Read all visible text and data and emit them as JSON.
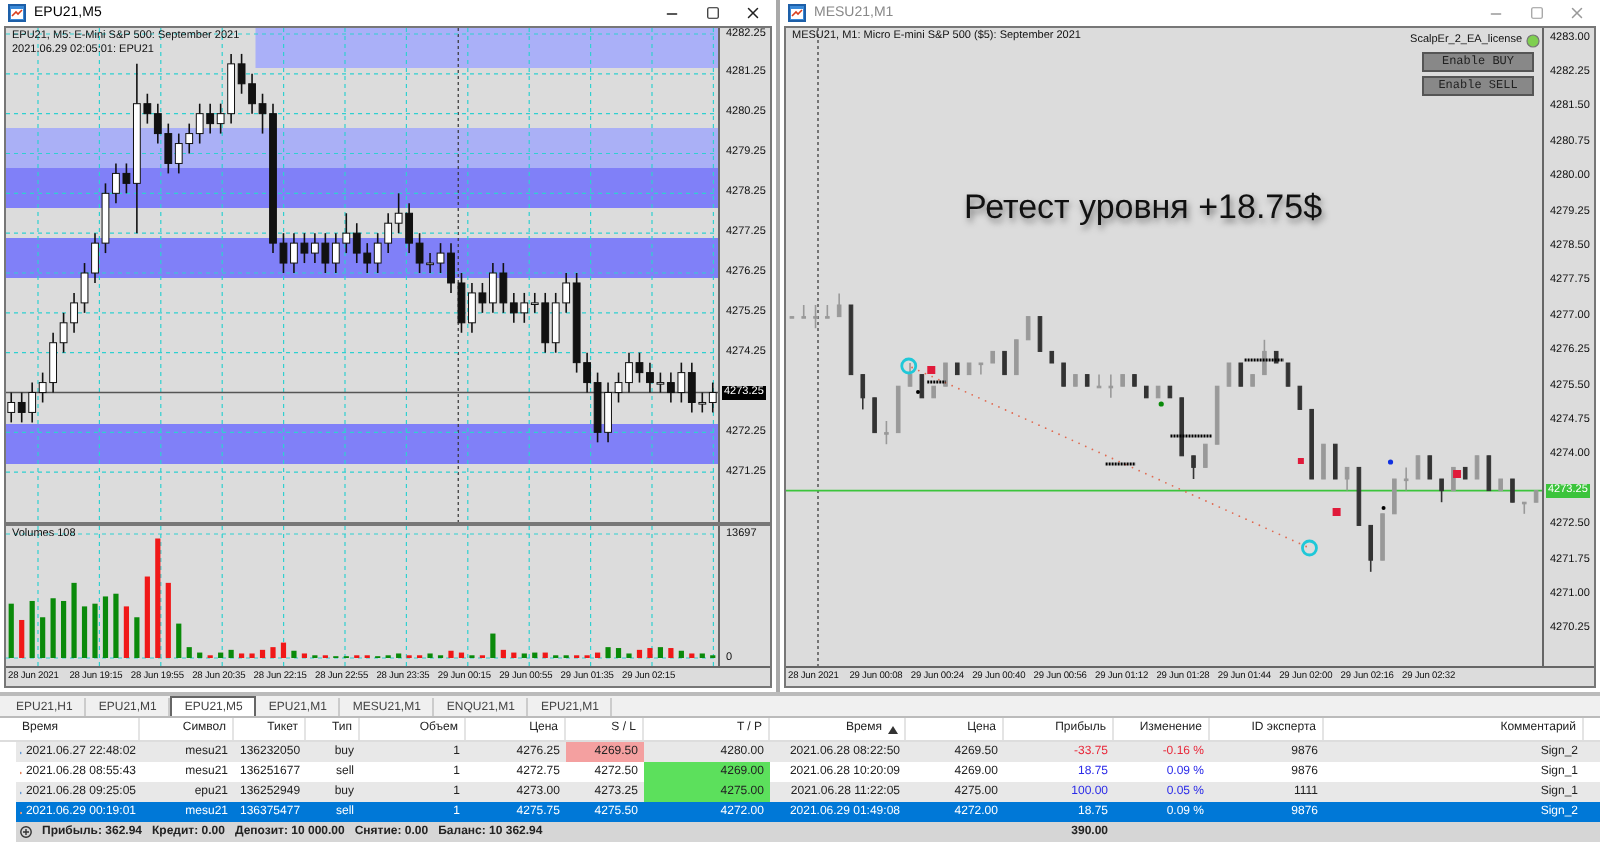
{
  "windows": [
    {
      "title": "EPU21,M5",
      "active": true,
      "chart": {
        "kind": "candles",
        "info": [
          "EPU21, M5:  E-Mini S&P 500: September 2021",
          "2021.06.29 02:05:01: EPU21"
        ],
        "chart_data": {
          "type": "candlestick",
          "ylim": [
            4270.0,
            4282.4
          ],
          "yticks": [
            {
              "value": 4282.25,
              "label": "4282.25"
            },
            {
              "value": 4281.25,
              "label": "4281.25"
            },
            {
              "value": 4280.25,
              "label": "4280.25"
            },
            {
              "value": 4279.25,
              "label": "4279.25"
            },
            {
              "value": 4278.25,
              "label": "4278.25"
            },
            {
              "value": 4277.25,
              "label": "4277.25"
            },
            {
              "value": 4276.25,
              "label": "4276.25"
            },
            {
              "value": 4275.25,
              "label": "4275.25"
            },
            {
              "value": 4274.25,
              "label": "4274.25"
            },
            {
              "value": 4272.25,
              "label": "4272.25"
            },
            {
              "value": 4271.25,
              "label": "4271.25"
            }
          ],
          "grid": true,
          "ref_lines": [
            {
              "axis": "y",
              "value": 4273.25
            }
          ],
          "annotations": [
            "4273.25"
          ],
          "categories": [
            null,
            null,
            null,
            null,
            null,
            null,
            null,
            null,
            null,
            null,
            null,
            null,
            null,
            null,
            null,
            null,
            null,
            null,
            null,
            null,
            null,
            null,
            null,
            null,
            null,
            null,
            null,
            null,
            null,
            null,
            null,
            null,
            null,
            null,
            null,
            null,
            null,
            null,
            null,
            null,
            null,
            null,
            null,
            null,
            null,
            null,
            null,
            null,
            null,
            null,
            null,
            null,
            null,
            null,
            null,
            null,
            null,
            null,
            null,
            null,
            null,
            null,
            null,
            null,
            null,
            null,
            null,
            null
          ],
          "ohlc": [
            [
              4272.75,
              4273.25,
              4272.5,
              4273.0
            ],
            [
              4273.0,
              4273.25,
              4272.5,
              4272.75
            ],
            [
              4272.75,
              4273.5,
              4272.5,
              4273.25
            ],
            [
              4273.25,
              4273.75,
              4273.0,
              4273.5
            ],
            [
              4273.5,
              4274.75,
              4273.25,
              4274.5
            ],
            [
              4274.5,
              4275.25,
              4274.25,
              4275.0
            ],
            [
              4275.0,
              4275.75,
              4274.75,
              4275.5
            ],
            [
              4275.5,
              4276.5,
              4275.25,
              4276.25
            ],
            [
              4276.25,
              4277.25,
              4276.0,
              4277.0
            ],
            [
              4277.0,
              4278.5,
              4276.75,
              4278.25
            ],
            [
              4278.25,
              4279.0,
              4278.0,
              4278.75
            ],
            [
              4278.75,
              4279.0,
              4278.25,
              4278.5
            ],
            [
              4278.5,
              4281.5,
              4277.25,
              4280.5
            ],
            [
              4280.5,
              4280.75,
              4280.0,
              4280.25
            ],
            [
              4280.25,
              4280.5,
              4279.5,
              4279.75
            ],
            [
              4279.75,
              4280.0,
              4278.75,
              4279.0
            ],
            [
              4279.0,
              4279.75,
              4278.75,
              4279.5
            ],
            [
              4279.5,
              4280.0,
              4279.25,
              4279.75
            ],
            [
              4279.75,
              4280.5,
              4279.5,
              4280.25
            ],
            [
              4280.25,
              4280.5,
              4279.75,
              4280.0
            ],
            [
              4280.0,
              4280.5,
              4279.75,
              4280.25
            ],
            [
              4280.25,
              4281.75,
              4280.0,
              4281.5
            ],
            [
              4281.5,
              4281.75,
              4280.75,
              4281.0
            ],
            [
              4281.0,
              4281.25,
              4280.25,
              4280.5
            ],
            [
              4280.5,
              4280.75,
              4279.75,
              4280.25
            ],
            [
              4280.25,
              4280.5,
              4276.75,
              4277.0
            ],
            [
              4277.0,
              4277.25,
              4276.25,
              4276.5
            ],
            [
              4276.5,
              4277.25,
              4276.25,
              4277.0
            ],
            [
              4277.0,
              4277.25,
              4276.5,
              4276.75
            ],
            [
              4276.75,
              4277.25,
              4276.5,
              4277.0
            ],
            [
              4277.0,
              4277.25,
              4276.25,
              4276.5
            ],
            [
              4276.5,
              4277.25,
              4276.25,
              4277.0
            ],
            [
              4277.0,
              4277.75,
              4276.75,
              4277.25
            ],
            [
              4277.25,
              4277.5,
              4276.5,
              4276.75
            ],
            [
              4276.75,
              4277.0,
              4276.25,
              4276.5
            ],
            [
              4276.5,
              4277.25,
              4276.25,
              4277.0
            ],
            [
              4277.0,
              4277.75,
              4276.75,
              4277.5
            ],
            [
              4277.5,
              4278.25,
              4277.25,
              4277.75
            ],
            [
              4277.75,
              4278.0,
              4276.75,
              4277.0
            ],
            [
              4277.0,
              4277.25,
              4276.25,
              4276.5
            ],
            [
              4276.5,
              4276.75,
              4276.25,
              4276.5
            ],
            [
              4276.5,
              4277.0,
              4276.25,
              4276.75
            ],
            [
              4276.75,
              4277.0,
              4275.75,
              4276.0
            ],
            [
              4276.0,
              4276.25,
              4274.75,
              4275.0
            ],
            [
              4275.0,
              4276.0,
              4274.75,
              4275.75
            ],
            [
              4275.75,
              4276.0,
              4275.25,
              4275.5
            ],
            [
              4275.5,
              4276.5,
              4275.25,
              4276.25
            ],
            [
              4276.25,
              4276.5,
              4275.25,
              4275.5
            ],
            [
              4275.5,
              4275.75,
              4275.0,
              4275.25
            ],
            [
              4275.25,
              4275.75,
              4275.0,
              4275.5
            ],
            [
              4275.5,
              4275.75,
              4275.25,
              4275.5
            ],
            [
              4275.5,
              4275.75,
              4274.25,
              4274.5
            ],
            [
              4274.5,
              4275.75,
              4274.25,
              4275.5
            ],
            [
              4275.5,
              4276.25,
              4275.25,
              4276.0
            ],
            [
              4276.0,
              4276.25,
              4273.75,
              4274.0
            ],
            [
              4274.0,
              4274.25,
              4273.25,
              4273.5
            ],
            [
              4273.5,
              4273.75,
              4272.0,
              4272.25
            ],
            [
              4272.25,
              4273.5,
              4272.0,
              4273.25
            ],
            [
              4273.25,
              4273.75,
              4273.0,
              4273.5
            ],
            [
              4273.5,
              4274.25,
              4273.25,
              4274.0
            ],
            [
              4274.0,
              4274.25,
              4273.5,
              4273.75
            ],
            [
              4273.75,
              4274.0,
              4273.25,
              4273.5
            ],
            [
              4273.5,
              4273.75,
              4273.25,
              4273.5
            ],
            [
              4273.5,
              4273.75,
              4273.0,
              4273.25
            ],
            [
              4273.25,
              4274.0,
              4273.0,
              4273.75
            ],
            [
              4273.75,
              4274.0,
              4272.75,
              4273.0
            ],
            [
              4273.0,
              4273.25,
              4272.75,
              4273.0
            ],
            [
              4273.0,
              4273.5,
              4272.75,
              4273.25
            ]
          ]
        },
        "volume": {
          "label": "Volumes 108",
          "chart_data": {
            "type": "bar",
            "ylim": [
              0,
              13697
            ],
            "grid": true,
            "yticks": [
              {
                "value": 13697,
                "label": "13697"
              },
              {
                "value": 0,
                "label": "0"
              }
            ],
            "categories": [
              null,
              null,
              null,
              null,
              null,
              null,
              null,
              null,
              null,
              null,
              null,
              null,
              null,
              null,
              null,
              null,
              null,
              null,
              null,
              null,
              null,
              null,
              null,
              null,
              null,
              null,
              null,
              null,
              null,
              null,
              null,
              null,
              null,
              null,
              null,
              null,
              null,
              null,
              null,
              null,
              null,
              null,
              null,
              null,
              null,
              null,
              null,
              null,
              null,
              null,
              null,
              null,
              null,
              null,
              null,
              null,
              null,
              null,
              null,
              null,
              null,
              null,
              null,
              null,
              null,
              null,
              null,
              null
            ],
            "values": [
              6000,
              4200,
              6300,
              4500,
              6600,
              6300,
              8300,
              5700,
              6000,
              6800,
              7100,
              5700,
              4500,
              9000,
              13200,
              8300,
              3800,
              1200,
              600,
              300,
              600,
              900,
              500,
              500,
              900,
              1200,
              1700,
              800,
              500,
              300,
              300,
              200,
              200,
              300,
              300,
              200,
              300,
              500,
              300,
              300,
              500,
              300,
              800,
              600,
              300,
              300,
              2700,
              900,
              600,
              500,
              600,
              600,
              300,
              300,
              300,
              300,
              600,
              1200,
              1100,
              500,
              900,
              1100,
              1200,
              1100,
              800,
              500,
              500,
              300
            ]
          }
        },
        "time_labels": [
          "28 Jun 2021",
          "28 Jun 19:15",
          "28 Jun 19:55",
          "28 Jun 20:35",
          "28 Jun 22:15",
          "28 Jun 22:55",
          "28 Jun 23:35",
          "29 Jun 00:15",
          "29 Jun 00:55",
          "29 Jun 01:35",
          "29 Jun 02:15"
        ]
      }
    },
    {
      "title": "MESU21,M1",
      "active": false,
      "chart": {
        "kind": "bars",
        "info": [
          "MESU21, M1:  Micro E-mini S&P 500 ($5): September 2021"
        ],
        "expert": "ScalpEr_2_EA_license",
        "buttons": [
          "Enable BUY",
          "Enable SELL"
        ],
        "caption": "Ретест уровня +18.75$",
        "chart_data": {
          "type": "candlestick",
          "ylim": [
            4269.47,
            4283.22
          ],
          "yticks": [
            {
              "value": 4283.0,
              "label": "4283.00"
            },
            {
              "value": 4282.25,
              "label": "4282.25"
            },
            {
              "value": 4281.5,
              "label": "4281.50"
            },
            {
              "value": 4280.75,
              "label": "4280.75"
            },
            {
              "value": 4280.0,
              "label": "4280.00"
            },
            {
              "value": 4279.25,
              "label": "4279.25"
            },
            {
              "value": 4278.5,
              "label": "4278.50"
            },
            {
              "value": 4277.75,
              "label": "4277.75"
            },
            {
              "value": 4277.0,
              "label": "4277.00"
            },
            {
              "value": 4276.25,
              "label": "4276.25"
            },
            {
              "value": 4275.5,
              "label": "4275.50"
            },
            {
              "value": 4274.75,
              "label": "4274.75"
            },
            {
              "value": 4274.0,
              "label": "4274.00"
            },
            {
              "value": 4272.5,
              "label": "4272.50"
            },
            {
              "value": 4271.75,
              "label": "4271.75"
            },
            {
              "value": 4271.0,
              "label": "4271.00"
            },
            {
              "value": 4270.25,
              "label": "4270.25"
            }
          ],
          "grid": false,
          "ref_lines": [
            {
              "axis": "y",
              "value": 4273.25
            }
          ],
          "annotations": [
            "4273.25"
          ],
          "categories": [
            null,
            null,
            null,
            null,
            null,
            null,
            null,
            null,
            null,
            null,
            null,
            null,
            null,
            null,
            null,
            null,
            null,
            null,
            null,
            null,
            null,
            null,
            null,
            null,
            null,
            null,
            null,
            null,
            null,
            null,
            null,
            null,
            null,
            null,
            null,
            null,
            null,
            null,
            null,
            null,
            null,
            null,
            null,
            null,
            null,
            null,
            null,
            null,
            null,
            null,
            null,
            null,
            null,
            null,
            null,
            null,
            null,
            null,
            null,
            null,
            null,
            null,
            null,
            null
          ],
          "ohlc": [
            [
              4277.0,
              4277.0,
              4277.0,
              4277.0
            ],
            [
              4277.0,
              4277.25,
              4277.0,
              4277.0
            ],
            [
              4277.0,
              4277.25,
              4276.75,
              4277.0
            ],
            [
              4277.0,
              4277.25,
              4277.0,
              4277.0
            ],
            [
              4277.0,
              4277.5,
              4277.0,
              4277.25
            ],
            [
              4277.25,
              4277.25,
              4275.75,
              4275.75
            ],
            [
              4275.75,
              4275.75,
              4275.0,
              4275.25
            ],
            [
              4275.25,
              4275.25,
              4274.5,
              4274.5
            ],
            [
              4274.5,
              4274.75,
              4274.25,
              4274.5
            ],
            [
              4274.5,
              4275.5,
              4274.5,
              4275.5
            ],
            [
              4275.5,
              4276.0,
              4275.5,
              4275.75
            ],
            [
              4275.75,
              4275.75,
              4275.25,
              4275.25
            ],
            [
              4275.25,
              4275.5,
              4275.25,
              4275.5
            ],
            [
              4275.5,
              4276.0,
              4275.5,
              4276.0
            ],
            [
              4276.0,
              4276.0,
              4275.75,
              4275.75
            ],
            [
              4275.75,
              4276.0,
              4275.75,
              4276.0
            ],
            [
              4276.0,
              4276.0,
              4275.75,
              4276.0
            ],
            [
              4276.0,
              4276.25,
              4276.0,
              4276.25
            ],
            [
              4276.25,
              4276.25,
              4275.75,
              4275.75
            ],
            [
              4275.75,
              4276.5,
              4275.75,
              4276.5
            ],
            [
              4276.5,
              4277.0,
              4276.5,
              4277.0
            ],
            [
              4277.0,
              4277.0,
              4276.25,
              4276.25
            ],
            [
              4276.25,
              4276.25,
              4276.0,
              4276.0
            ],
            [
              4276.0,
              4276.0,
              4275.5,
              4275.5
            ],
            [
              4275.5,
              4275.75,
              4275.5,
              4275.75
            ],
            [
              4275.75,
              4275.75,
              4275.5,
              4275.5
            ],
            [
              4275.5,
              4275.75,
              4275.5,
              4275.5
            ],
            [
              4275.5,
              4275.75,
              4275.25,
              4275.5
            ],
            [
              4275.5,
              4275.75,
              4275.5,
              4275.75
            ],
            [
              4275.75,
              4275.75,
              4275.5,
              4275.5
            ],
            [
              4275.5,
              4275.5,
              4275.25,
              4275.25
            ],
            [
              4275.25,
              4275.5,
              4275.25,
              4275.5
            ],
            [
              4275.5,
              4275.5,
              4275.25,
              4275.25
            ],
            [
              4275.25,
              4275.25,
              4274.0,
              4274.0
            ],
            [
              4274.0,
              4274.0,
              4273.5,
              4273.75
            ],
            [
              4273.75,
              4274.25,
              4273.75,
              4274.25
            ],
            [
              4274.25,
              4275.5,
              4274.25,
              4275.5
            ],
            [
              4275.5,
              4276.0,
              4275.5,
              4276.0
            ],
            [
              4276.0,
              4276.0,
              4275.5,
              4275.5
            ],
            [
              4275.5,
              4275.75,
              4275.5,
              4275.75
            ],
            [
              4275.75,
              4276.5,
              4275.75,
              4276.25
            ],
            [
              4276.25,
              4276.25,
              4276.0,
              4276.0
            ],
            [
              4276.0,
              4276.0,
              4275.5,
              4275.5
            ],
            [
              4275.5,
              4275.5,
              4275.0,
              4275.0
            ],
            [
              4275.0,
              4275.0,
              4273.5,
              4273.5
            ],
            [
              4273.5,
              4274.25,
              4273.5,
              4274.25
            ],
            [
              4274.25,
              4274.25,
              4273.5,
              4273.5
            ],
            [
              4273.5,
              4273.75,
              4273.25,
              4273.75
            ],
            [
              4273.75,
              4273.75,
              4272.5,
              4272.5
            ],
            [
              4272.5,
              4272.5,
              4271.5,
              4271.75
            ],
            [
              4271.75,
              4272.75,
              4271.75,
              4272.75
            ],
            [
              4272.75,
              4273.5,
              4272.75,
              4273.5
            ],
            [
              4273.5,
              4273.75,
              4273.25,
              4273.5
            ],
            [
              4273.5,
              4274.0,
              4273.5,
              4274.0
            ],
            [
              4274.0,
              4274.0,
              4273.5,
              4273.5
            ],
            [
              4273.5,
              4273.5,
              4273.0,
              4273.25
            ],
            [
              4273.25,
              4273.75,
              4273.25,
              4273.75
            ],
            [
              4273.75,
              4273.75,
              4273.5,
              4273.5
            ],
            [
              4273.5,
              4274.0,
              4273.5,
              4274.0
            ],
            [
              4274.0,
              4274.0,
              4273.25,
              4273.25
            ],
            [
              4273.25,
              4273.5,
              4273.25,
              4273.5
            ],
            [
              4273.5,
              4273.5,
              4273.0,
              4273.0
            ],
            [
              4273.0,
              4273.0,
              4272.75,
              4273.0
            ],
            [
              4273.0,
              4273.25,
              4273.0,
              4273.25
            ]
          ]
        },
        "time_labels": [
          "28 Jun 2021",
          "29 Jun 00:08",
          "29 Jun 00:24",
          "29 Jun 00:40",
          "29 Jun 00:56",
          "29 Jun 01:12",
          "29 Jun 01:28",
          "29 Jun 01:44",
          "29 Jun 02:00",
          "29 Jun 02:16",
          "29 Jun 02:32"
        ]
      }
    }
  ],
  "tabs": [
    {
      "label": "EPU21,H1",
      "selected": false
    },
    {
      "label": "EPU21,M1",
      "selected": false
    },
    {
      "label": "EPU21,M5",
      "selected": true
    },
    {
      "label": "EPU21,M1",
      "selected": false
    },
    {
      "label": "MESU21,M1",
      "selected": false
    },
    {
      "label": "ENQU21,M1",
      "selected": false
    },
    {
      "label": "EPU21,M1",
      "selected": false
    }
  ],
  "table": {
    "columns": [
      {
        "label": "Время",
        "sorted": false
      },
      {
        "label": "Символ",
        "sorted": false
      },
      {
        "label": "Тикет",
        "sorted": false
      },
      {
        "label": "Тип",
        "sorted": false
      },
      {
        "label": "Объем",
        "sorted": false
      },
      {
        "label": "Цена",
        "sorted": false
      },
      {
        "label": "S / L",
        "sorted": false
      },
      {
        "label": "T / P",
        "sorted": false
      },
      {
        "label": "Время",
        "sorted": true
      },
      {
        "label": "Цена",
        "sorted": false
      },
      {
        "label": "Прибыль",
        "sorted": false
      },
      {
        "label": "Изменение",
        "sorted": false
      },
      {
        "label": "ID эксперта",
        "sorted": false
      },
      {
        "label": "Комментарий",
        "sorted": false
      }
    ],
    "rows": [
      {
        "kind": "buy",
        "selected": false,
        "sl_hit": true,
        "tp_hit": false,
        "color": "#e8283a",
        "cells": [
          "2021.06.27 22:48:02",
          "mesu21",
          "136232050",
          "buy",
          "1",
          "4276.25",
          "4269.50",
          "4280.00",
          "2021.06.28 08:22:50",
          "4269.50",
          "-33.75",
          "-0.16 %",
          "9876",
          "Sign_2"
        ]
      },
      {
        "kind": "sell",
        "selected": false,
        "sl_hit": false,
        "tp_hit": true,
        "color": "#2a2ae8",
        "cells": [
          "2021.06.28 08:55:43",
          "mesu21",
          "136251677",
          "sell",
          "1",
          "4272.75",
          "4272.50",
          "4269.00",
          "2021.06.28 10:20:09",
          "4269.00",
          "18.75",
          "0.09 %",
          "9876",
          "Sign_1"
        ]
      },
      {
        "kind": "buy",
        "selected": false,
        "sl_hit": false,
        "tp_hit": true,
        "color": "#2a2ae8",
        "cells": [
          "2021.06.28 09:25:05",
          "epu21",
          "136252949",
          "buy",
          "1",
          "4273.00",
          "4273.25",
          "4275.00",
          "2021.06.28 11:22:05",
          "4275.00",
          "100.00",
          "0.05 %",
          "1111",
          "Sign_1"
        ]
      },
      {
        "kind": "sell",
        "selected": true,
        "sl_hit": false,
        "tp_hit": false,
        "cells": [
          "2021.06.29 00:19:01",
          "mesu21",
          "136375477",
          "sell",
          "1",
          "4275.75",
          "4275.50",
          "4272.00",
          "2021.06.29 01:49:08",
          "4272.00",
          "18.75",
          "0.09 %",
          "9876",
          "Sign_2"
        ]
      }
    ],
    "summary": [
      "Прибыль: 362.94",
      "Кредит: 0.00",
      "Депозит: 10 000.00",
      "Снятие: 0.00",
      "Баланс: 10 362.94"
    ],
    "total_profit": "390.00"
  }
}
